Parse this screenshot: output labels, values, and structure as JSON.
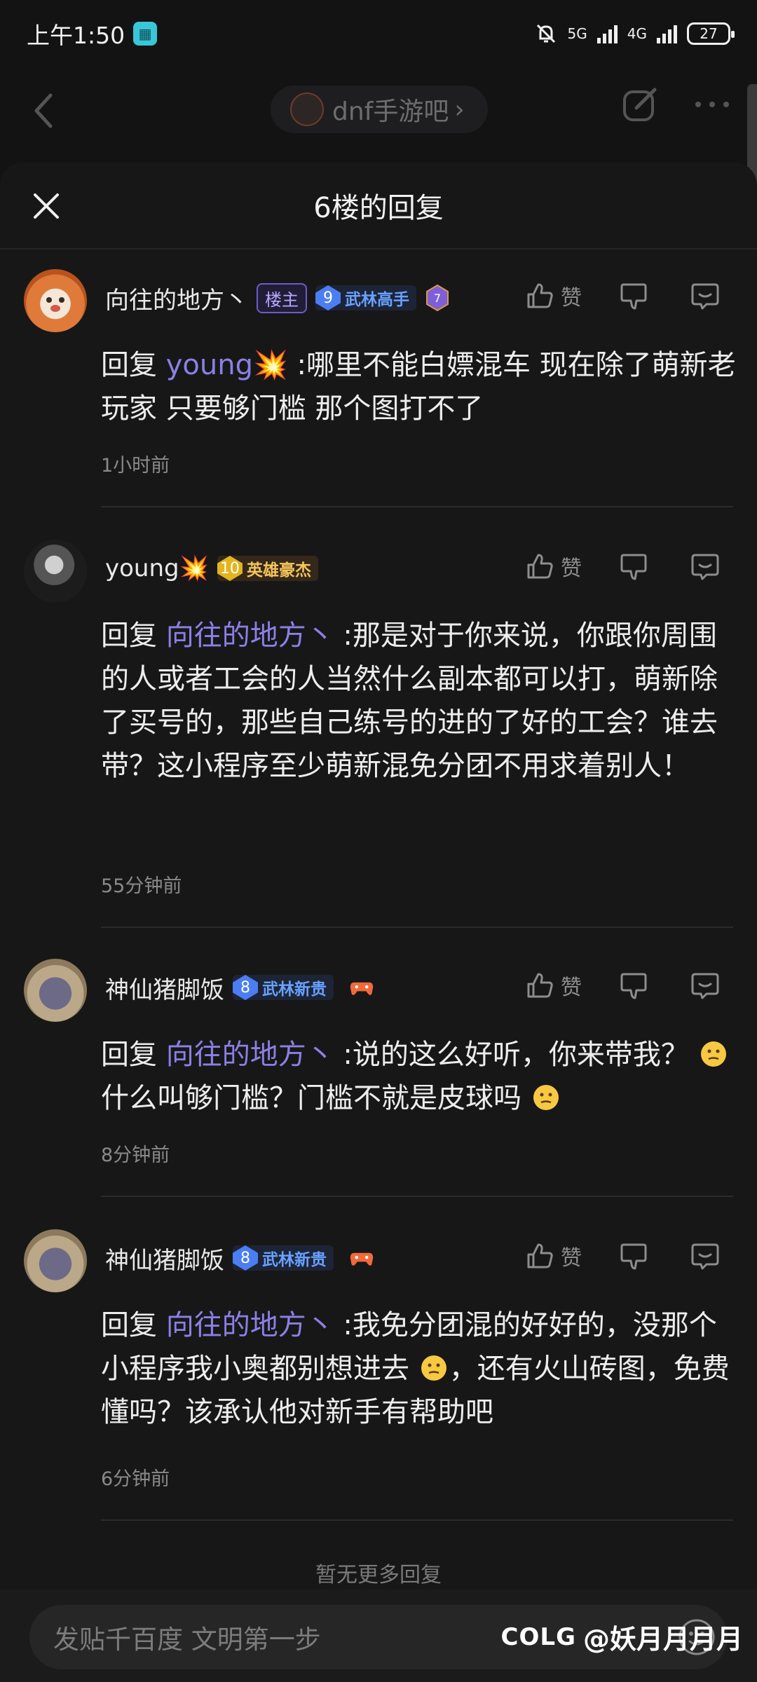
{
  "status": {
    "time": "上午1:50",
    "network1": "5G",
    "network2": "4G",
    "battery": "27"
  },
  "nav": {
    "forum_name": "dnf手游吧",
    "chevron": "›"
  },
  "sheet": {
    "title": "6楼的回复",
    "no_more": "暂无更多回复"
  },
  "actions": {
    "like_label": "赞"
  },
  "comments": [
    {
      "username": "向往的地方丶",
      "owner_tag": "楼主",
      "level": "9",
      "level_title": "武林高手",
      "medal": "7",
      "reply_prefix": "回复 ",
      "mention": "young💥",
      "content": " :哪里不能白嫖混车 现在除了萌新老玩家 只要够门槛 那个图打不了",
      "time": "1小时前"
    },
    {
      "username": "young💥",
      "level": "10",
      "level_title": "英雄豪杰",
      "reply_prefix": "回复 ",
      "mention": "向往的地方丶",
      "content": " :那是对于你来说，你跟你周围的人或者工会的人当然什么副本都可以打，萌新除了买号的，那些自己练号的进的了好的工会？谁去带？这小程序至少萌新混免分团不用求着别人！",
      "time": "55分钟前"
    },
    {
      "username": "神仙猪脚饭",
      "level": "8",
      "level_title": "武林新贵",
      "reply_prefix": "回复 ",
      "mention": "向往的地方丶",
      "content_a": " :说的这么好听，你来带我？",
      "content_b": "什么叫够门槛？门槛不就是皮球吗",
      "time": "8分钟前"
    },
    {
      "username": "神仙猪脚饭",
      "level": "8",
      "level_title": "武林新贵",
      "reply_prefix": "回复 ",
      "mention": "向往的地方丶",
      "content_a": " :我免分团混的好好的，没那个小程序我小奥都别想进去",
      "content_b": "，还有火山砖图，免费懂吗？该承认他对新手有帮助吧",
      "time": "6分钟前"
    }
  ],
  "bottom": {
    "placeholder": "发贴千百度 文明第一步"
  },
  "watermark": {
    "logo": "COLG",
    "handle": "@妖月月月月"
  },
  "icons": [
    "back-icon",
    "edit-icon",
    "more-icon",
    "close-icon",
    "like-icon",
    "dislike-icon",
    "reply-icon",
    "emoji-icon",
    "thinking-emoji-icon",
    "controller-icon"
  ]
}
